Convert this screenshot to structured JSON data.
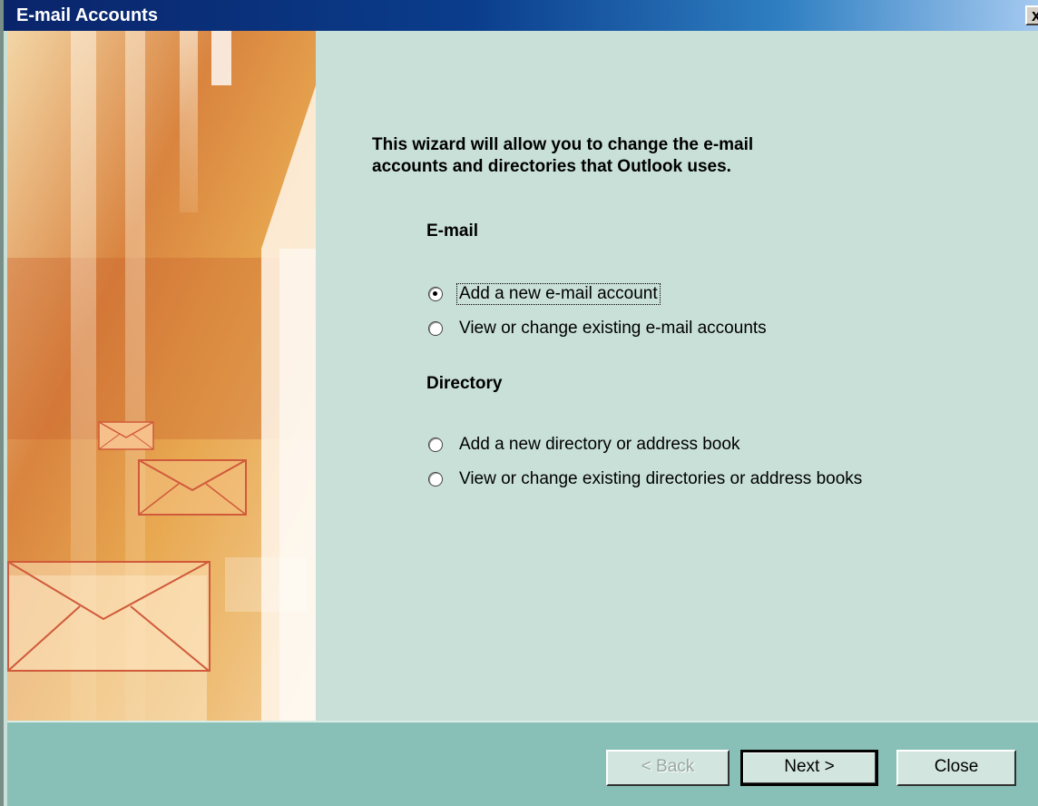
{
  "window": {
    "title": "E-mail Accounts",
    "close_glyph": "x"
  },
  "intro": {
    "line1": "This wizard will allow you to change the e-mail",
    "line2": "accounts and directories that Outlook uses."
  },
  "email_section": {
    "title": "E-mail",
    "options": [
      {
        "label": "Add a new e-mail account",
        "checked": true
      },
      {
        "label": "View or change existing e-mail accounts",
        "checked": false
      }
    ]
  },
  "directory_section": {
    "title": "Directory",
    "options": [
      {
        "label": "Add a new directory or address book",
        "checked": false
      },
      {
        "label": "View or change existing directories or address books",
        "checked": false
      }
    ]
  },
  "buttons": {
    "back": "< Back",
    "next": "Next >",
    "close": "Close"
  },
  "side_art": {
    "icon": "envelope-icon",
    "colors": {
      "orange": "#d2783c",
      "gold": "#e8a850",
      "pale": "#fbe8c8"
    }
  }
}
